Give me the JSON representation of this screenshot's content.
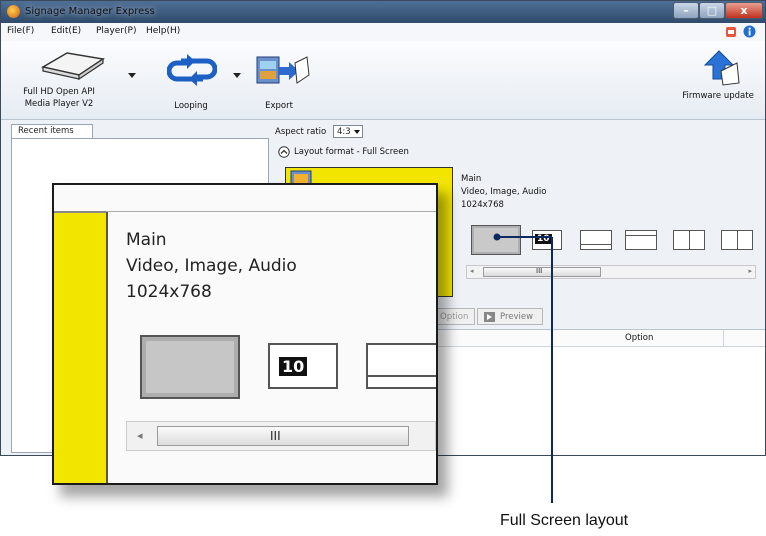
{
  "window": {
    "title": "Signage Manager Express",
    "min": "–",
    "max": "□",
    "close": "x"
  },
  "menu": [
    {
      "label": "File(F)"
    },
    {
      "label": "Edit(E)"
    },
    {
      "label": "Player(P)"
    },
    {
      "label": "Help(H)"
    }
  ],
  "ribbon": {
    "player_label_1": "Full HD Open API",
    "player_label_2": "Media Player V2",
    "looping_label": "Looping",
    "export_label": "Export",
    "firmware_label": "Firmware update"
  },
  "left_pane": {
    "tab_label": "Recent items"
  },
  "right_pane": {
    "aspect_label": "Aspect ratio",
    "aspect_value": "4:3",
    "layout_format": "Layout format - Full Screen",
    "zone_name": "Main",
    "zone_types": "Video, Image, Audio",
    "zone_resolution": "1024x768",
    "loop_count": "10",
    "scroll_grip": "III",
    "option_button": "Option",
    "preview_button": "Preview",
    "table_header_option": "Option"
  },
  "magnifier": {
    "zone_name": "Main",
    "zone_types": "Video, Image, Audio",
    "zone_resolution": "1024x768",
    "loop_count": "10",
    "scroll_grip": "III"
  },
  "callout": {
    "label": "Full Screen layout"
  },
  "colors": {
    "zone_yellow": "#f2e600",
    "titlebar": "#3a5a80",
    "close_red": "#c83a26"
  }
}
